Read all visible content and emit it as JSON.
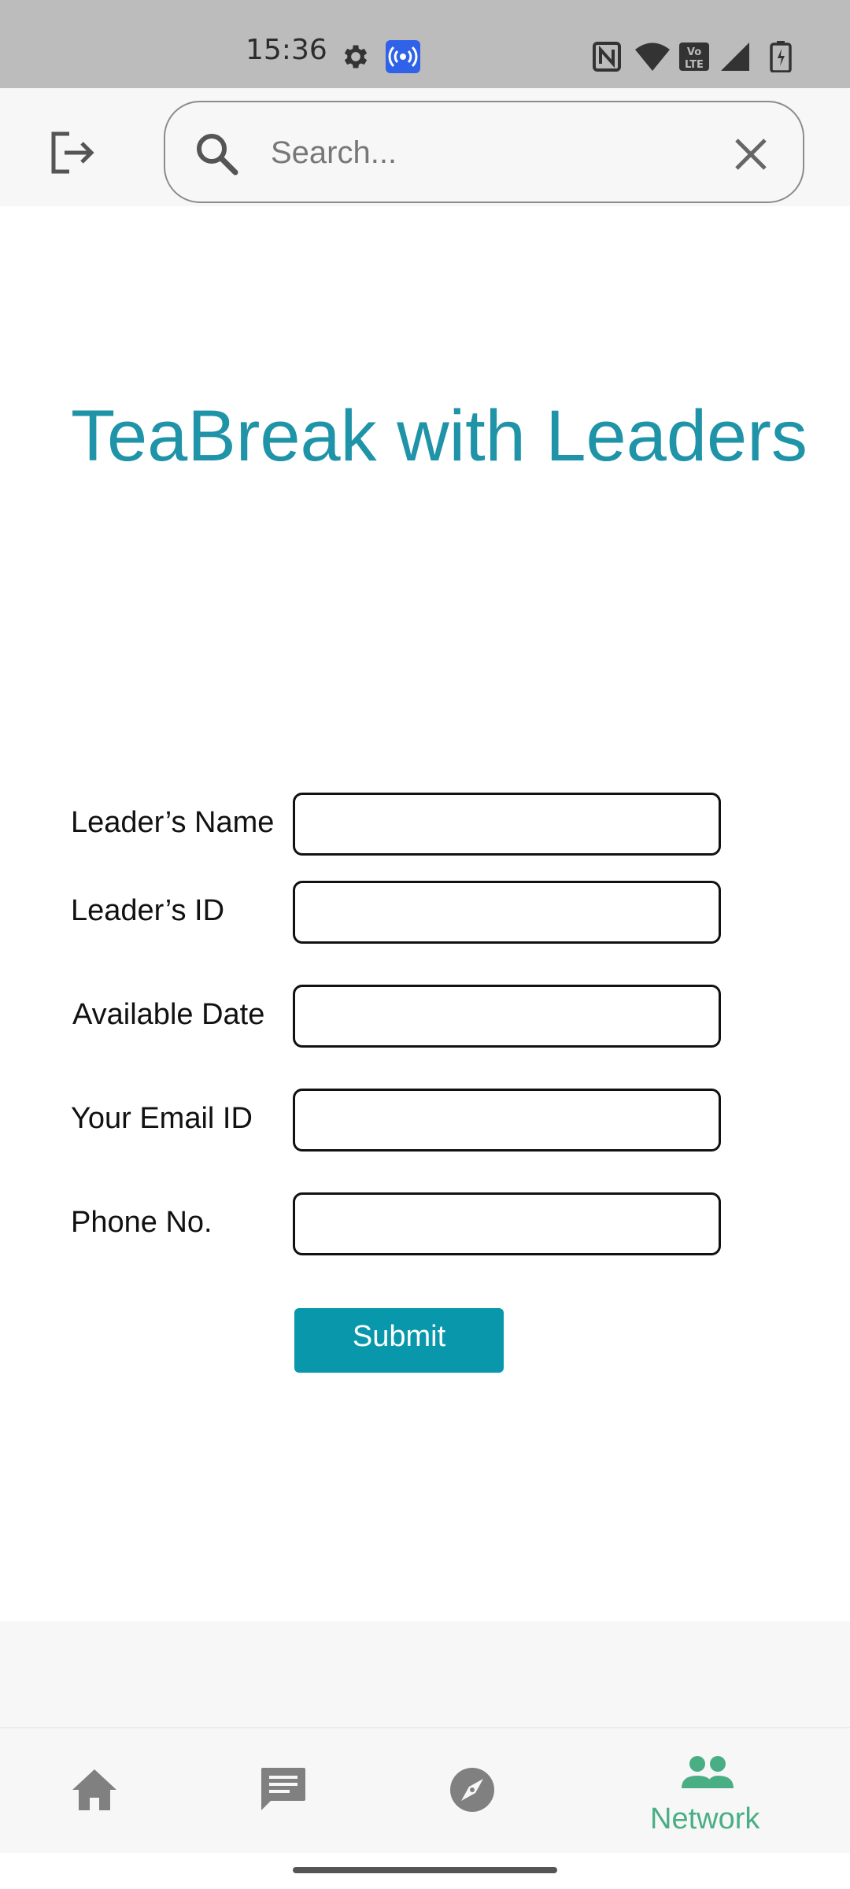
{
  "status_bar": {
    "time": "15:36",
    "icons": [
      "gear-icon",
      "hotspot-icon",
      "nfc-icon",
      "wifi-icon",
      "volte-icon",
      "signal-icon",
      "battery-icon"
    ]
  },
  "header": {
    "logout_icon": "logout-icon",
    "search": {
      "placeholder": "Search...",
      "value": "",
      "icon": "search-icon",
      "clear_icon": "close-icon"
    }
  },
  "page": {
    "title": "TeaBreak with Leaders"
  },
  "form": {
    "fields": [
      {
        "label": "Leader’s Name",
        "value": ""
      },
      {
        "label": "Leader’s ID",
        "value": ""
      },
      {
        "label": "Available Date",
        "value": ""
      },
      {
        "label": "Your Email ID",
        "value": ""
      },
      {
        "label": "Phone No.",
        "value": ""
      }
    ],
    "submit_label": "Submit"
  },
  "bottom_nav": {
    "items": [
      {
        "icon": "home-icon",
        "label": ""
      },
      {
        "icon": "chat-icon",
        "label": ""
      },
      {
        "icon": "compass-icon",
        "label": ""
      },
      {
        "icon": "people-icon",
        "label": "Network",
        "active": true
      }
    ]
  },
  "colors": {
    "accent": "#1f93a7",
    "button": "#0897ab",
    "nav_active": "#4aae84",
    "nav_inactive": "#808080"
  }
}
